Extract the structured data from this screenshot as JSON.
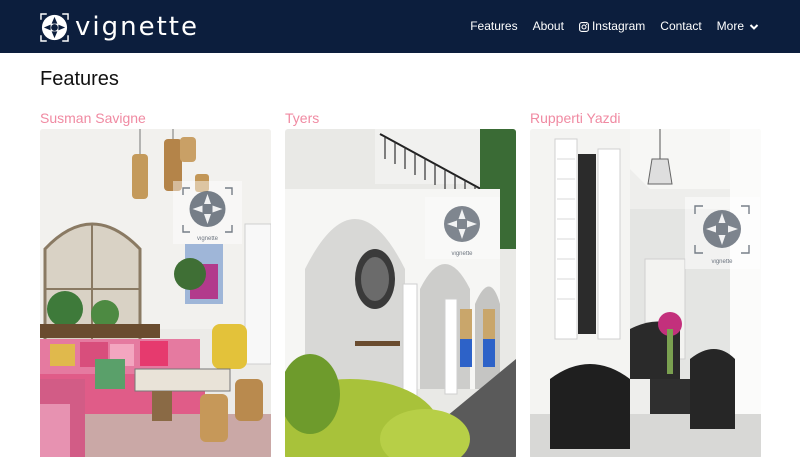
{
  "brand": {
    "name": "vignette"
  },
  "nav": {
    "items": [
      {
        "label": "Features"
      },
      {
        "label": "About"
      },
      {
        "label": "Instagram",
        "icon": "instagram-icon"
      },
      {
        "label": "Contact"
      },
      {
        "label": "More",
        "icon": "chevron-down-icon"
      }
    ]
  },
  "page": {
    "title": "Features"
  },
  "features": [
    {
      "title": "Susman Savigne",
      "watermark": "vignette"
    },
    {
      "title": "Tyers",
      "watermark": "vignette"
    },
    {
      "title": "Rupperti Yazdi",
      "watermark": "vignette"
    }
  ],
  "colors": {
    "navbar": "#0c1e3d",
    "accent": "#f08aa2",
    "text": "#111111"
  }
}
